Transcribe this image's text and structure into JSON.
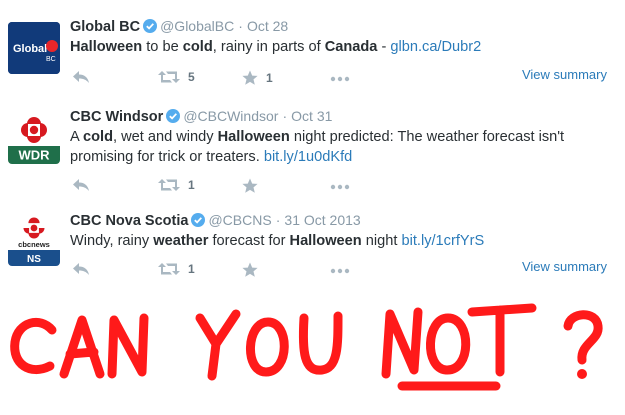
{
  "tweets": [
    {
      "name": "Global BC",
      "handle": "@GlobalBC",
      "date": "Oct 28",
      "text_parts": [
        "Halloween",
        " to be ",
        "cold",
        ", rainy in parts of ",
        "Canada",
        " - "
      ],
      "link": "glbn.ca/Dubr2",
      "retweets": "5",
      "favorites": "1",
      "view_summary": "View summary",
      "avatar_text": "Global",
      "avatar_sub": "BC"
    },
    {
      "name": "CBC Windsor",
      "handle": "@CBCWindsor",
      "date": "Oct 31",
      "text_parts": [
        "A ",
        "cold",
        ", wet and windy ",
        "Halloween",
        " night predicted: The weather forecast isn't promising for trick or treaters. "
      ],
      "link": "bit.ly/1u0dKfd",
      "retweets": "1",
      "avatar_label": "WDR"
    },
    {
      "name": "CBC Nova Scotia",
      "handle": "@CBCNS",
      "date": "31 Oct 2013",
      "text_parts": [
        "Windy, rainy ",
        "weather",
        " forecast for ",
        "Halloween",
        " night "
      ],
      "link": "bit.ly/1crfYrS",
      "retweets": "1",
      "view_summary": "View summary",
      "avatar_brand": "cbcnews",
      "avatar_label": "NS"
    }
  ],
  "separator": "·",
  "caption": {
    "words": [
      "CAN",
      "YOU",
      "NOT",
      "?"
    ],
    "color": "#ff1a1a"
  },
  "icons": [
    "reply-icon",
    "retweet-icon",
    "favorite-icon",
    "more-icon",
    "verified-icon"
  ],
  "colors": {
    "link": "#2b7bb9",
    "muted": "#8899a6",
    "text": "#292f33",
    "icon": "#aab8c2",
    "verified": "#55acee"
  }
}
